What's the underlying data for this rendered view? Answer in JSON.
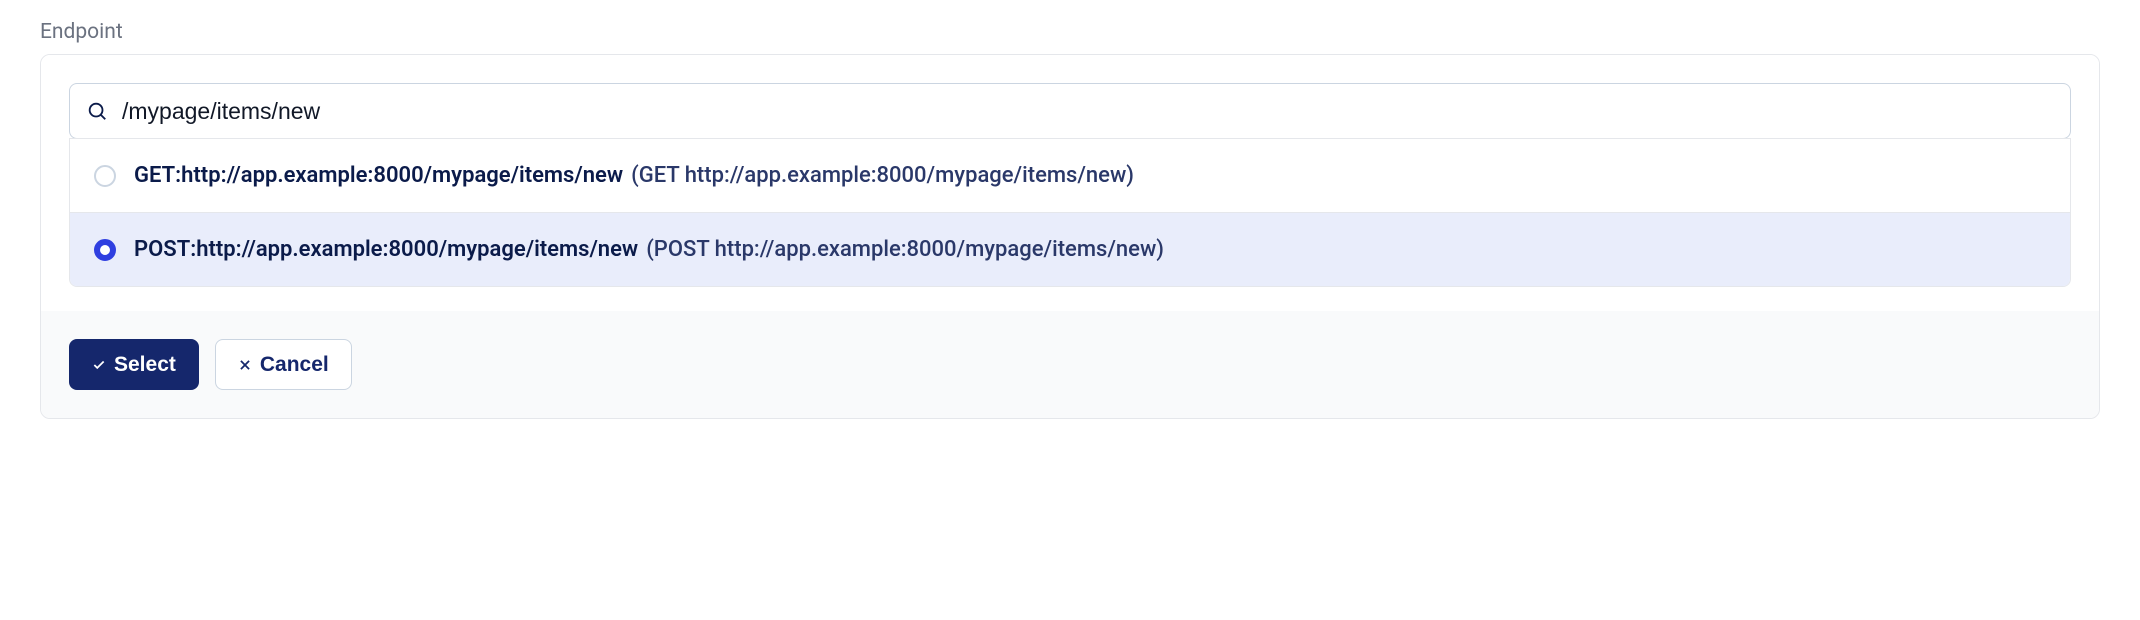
{
  "label": "Endpoint",
  "search": {
    "value": "/mypage/items/new"
  },
  "options": [
    {
      "label": "GET:http://app.example:8000/mypage/items/new",
      "hint": "(GET http://app.example:8000/mypage/items/new)",
      "selected": false
    },
    {
      "label": "POST:http://app.example:8000/mypage/items/new",
      "hint": "(POST http://app.example:8000/mypage/items/new)",
      "selected": true
    }
  ],
  "buttons": {
    "select": "Select",
    "cancel": "Cancel"
  }
}
